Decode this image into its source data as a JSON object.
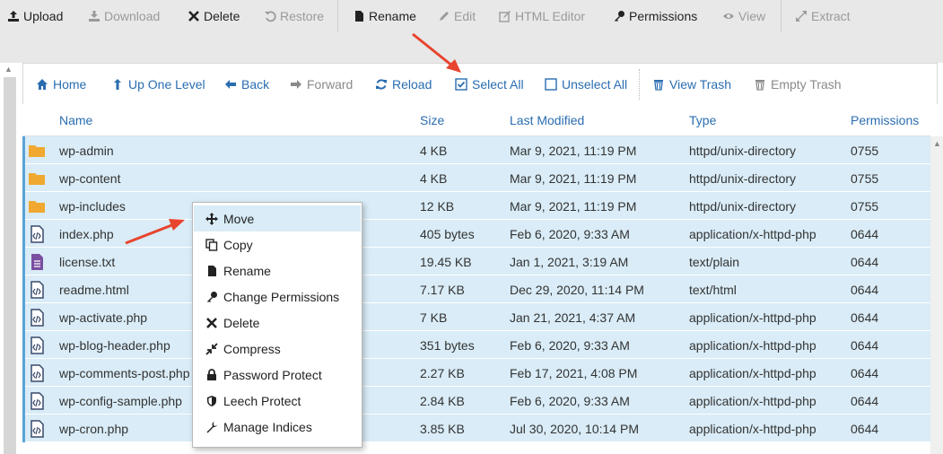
{
  "toolbar": {
    "upload": "Upload",
    "download": "Download",
    "delete": "Delete",
    "restore": "Restore",
    "rename": "Rename",
    "edit": "Edit",
    "html_editor": "HTML Editor",
    "permissions": "Permissions",
    "view": "View",
    "extract": "Extract"
  },
  "nav": {
    "home": "Home",
    "up_one_level": "Up One Level",
    "back": "Back",
    "forward": "Forward",
    "reload": "Reload",
    "select_all": "Select All",
    "unselect_all": "Unselect All",
    "view_trash": "View Trash",
    "empty_trash": "Empty Trash"
  },
  "table": {
    "headers": {
      "name": "Name",
      "size": "Size",
      "modified": "Last Modified",
      "type": "Type",
      "permissions": "Permissions"
    },
    "rows": [
      {
        "icon": "folder-icon",
        "name": "wp-admin",
        "size": "4 KB",
        "modified": "Mar 9, 2021, 11:19 PM",
        "type": "httpd/unix-directory",
        "perms": "0755"
      },
      {
        "icon": "folder-icon",
        "name": "wp-content",
        "size": "4 KB",
        "modified": "Mar 9, 2021, 11:19 PM",
        "type": "httpd/unix-directory",
        "perms": "0755"
      },
      {
        "icon": "folder-icon",
        "name": "wp-includes",
        "size": "12 KB",
        "modified": "Mar 9, 2021, 11:19 PM",
        "type": "httpd/unix-directory",
        "perms": "0755"
      },
      {
        "icon": "code-file-icon",
        "name": "index.php",
        "size": "405 bytes",
        "modified": "Feb 6, 2020, 9:33 AM",
        "type": "application/x-httpd-php",
        "perms": "0644"
      },
      {
        "icon": "text-file-icon",
        "name": "license.txt",
        "size": "19.45 KB",
        "modified": "Jan 1, 2021, 3:19 AM",
        "type": "text/plain",
        "perms": "0644"
      },
      {
        "icon": "code-file-icon",
        "name": "readme.html",
        "size": "7.17 KB",
        "modified": "Dec 29, 2020, 11:14 PM",
        "type": "text/html",
        "perms": "0644"
      },
      {
        "icon": "code-file-icon",
        "name": "wp-activate.php",
        "size": "7 KB",
        "modified": "Jan 21, 2021, 4:37 AM",
        "type": "application/x-httpd-php",
        "perms": "0644"
      },
      {
        "icon": "code-file-icon",
        "name": "wp-blog-header.php",
        "size": "351 bytes",
        "modified": "Feb 6, 2020, 9:33 AM",
        "type": "application/x-httpd-php",
        "perms": "0644"
      },
      {
        "icon": "code-file-icon",
        "name": "wp-comments-post.php",
        "size": "2.27 KB",
        "modified": "Feb 17, 2021, 4:08 PM",
        "type": "application/x-httpd-php",
        "perms": "0644"
      },
      {
        "icon": "code-file-icon",
        "name": "wp-config-sample.php",
        "size": "2.84 KB",
        "modified": "Feb 6, 2020, 9:33 AM",
        "type": "application/x-httpd-php",
        "perms": "0644"
      },
      {
        "icon": "code-file-icon",
        "name": "wp-cron.php",
        "size": "3.85 KB",
        "modified": "Jul 30, 2020, 10:14 PM",
        "type": "application/x-httpd-php",
        "perms": "0644"
      }
    ]
  },
  "context_menu": {
    "items": [
      "Move",
      "Copy",
      "Rename",
      "Change Permissions",
      "Delete",
      "Compress",
      "Password Protect",
      "Leech Protect",
      "Manage Indices"
    ]
  },
  "colors": {
    "accent": "#2a6db0",
    "selected_row": "#d9ecf7",
    "folder": "#f0a830",
    "text_file": "#7a4fa0",
    "arrow": "#e8442e"
  }
}
